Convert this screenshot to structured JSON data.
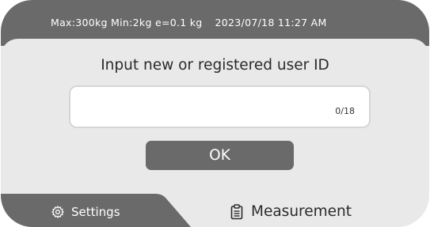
{
  "status_bar": {
    "scale_spec": "Max:300kg Min:2kg e=0.1 kg",
    "datetime": "2023/07/18 11:27 AM"
  },
  "main": {
    "prompt": "Input new or registered user ID",
    "user_id_input": {
      "value": "",
      "counter": "0/18"
    },
    "ok_label": "OK"
  },
  "bottom_nav": {
    "settings": {
      "label": "Settings",
      "icon": "gear-icon",
      "active": true
    },
    "measurement": {
      "label": "Measurement",
      "icon": "clipboard-icon",
      "active": false
    }
  },
  "colors": {
    "header_bg": "#6a6a6a",
    "panel_bg": "#e9e9e9",
    "button_bg": "#6a6a6a",
    "input_bg": "#ffffff"
  }
}
